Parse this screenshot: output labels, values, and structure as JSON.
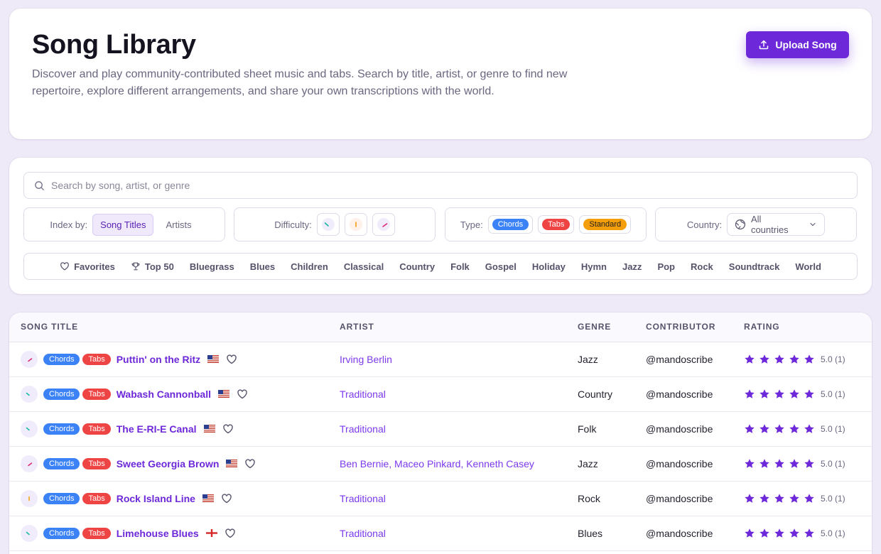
{
  "header": {
    "title": "Song Library",
    "description": "Discover and play community-contributed sheet music and tabs. Search by title, artist, or genre to find new repertoire, explore different arrangements, and share your own transcriptions with the world.",
    "upload_label": "Upload Song"
  },
  "search": {
    "placeholder": "Search by song, artist, or genre"
  },
  "filters": {
    "index_label": "Index by:",
    "index_options": [
      "Song Titles",
      "Artists"
    ],
    "index_selected": "Song Titles",
    "difficulty_label": "Difficulty:",
    "difficulty_levels": [
      "easy",
      "intermediate",
      "hard"
    ],
    "type_label": "Type:",
    "types": [
      "Chords",
      "Tabs",
      "Standard"
    ],
    "country_label": "Country:",
    "country_value": "All countries"
  },
  "genres": [
    "Favorites",
    "Top 50",
    "Bluegrass",
    "Blues",
    "Children",
    "Classical",
    "Country",
    "Folk",
    "Gospel",
    "Holiday",
    "Hymn",
    "Jazz",
    "Pop",
    "Rock",
    "Soundtrack",
    "World"
  ],
  "table": {
    "columns": [
      "SONG TITLE",
      "ARTIST",
      "GENRE",
      "CONTRIBUTOR",
      "RATING"
    ],
    "rows": [
      {
        "difficulty": "hard",
        "tags": [
          "Chords",
          "Tabs"
        ],
        "title": "Puttin' on the Ritz",
        "flag": "us",
        "artist": "Irving Berlin",
        "genre": "Jazz",
        "contributor": "@mandoscribe",
        "stars": 5,
        "rating": "5.0 (1)"
      },
      {
        "difficulty": "easy",
        "tags": [
          "Chords",
          "Tabs"
        ],
        "title": "Wabash Cannonball",
        "flag": "us",
        "artist": "Traditional",
        "genre": "Country",
        "contributor": "@mandoscribe",
        "stars": 5,
        "rating": "5.0 (1)"
      },
      {
        "difficulty": "easy",
        "tags": [
          "Chords",
          "Tabs"
        ],
        "title": "The E-RI-E Canal",
        "flag": "us",
        "artist": "Traditional",
        "genre": "Folk",
        "contributor": "@mandoscribe",
        "stars": 5,
        "rating": "5.0 (1)"
      },
      {
        "difficulty": "hard",
        "tags": [
          "Chords",
          "Tabs"
        ],
        "title": "Sweet Georgia Brown",
        "flag": "us",
        "artist": "Ben Bernie, Maceo Pinkard, Kenneth Casey",
        "genre": "Jazz",
        "contributor": "@mandoscribe",
        "stars": 5,
        "rating": "5.0 (1)"
      },
      {
        "difficulty": "intermediate",
        "tags": [
          "Chords",
          "Tabs"
        ],
        "title": "Rock Island Line",
        "flag": "us",
        "artist": "Traditional",
        "genre": "Rock",
        "contributor": "@mandoscribe",
        "stars": 5,
        "rating": "5.0 (1)"
      },
      {
        "difficulty": "easy",
        "tags": [
          "Chords",
          "Tabs"
        ],
        "title": "Limehouse Blues",
        "flag": "england",
        "artist": "Traditional",
        "genre": "Blues",
        "contributor": "@mandoscribe",
        "stars": 5,
        "rating": "5.0 (1)"
      }
    ]
  },
  "colors": {
    "accent": "#6d28d9",
    "chords": "#3b82f6",
    "tabs": "#ef4444",
    "standard": "#f59e0b",
    "star": "#6d28d9"
  },
  "icons": {
    "upload": "upload-icon",
    "search": "search-icon",
    "globe": "globe-icon",
    "chevron": "chevron-down-icon",
    "heart": "heart-icon",
    "trophy": "trophy-icon",
    "star": "star-icon"
  }
}
